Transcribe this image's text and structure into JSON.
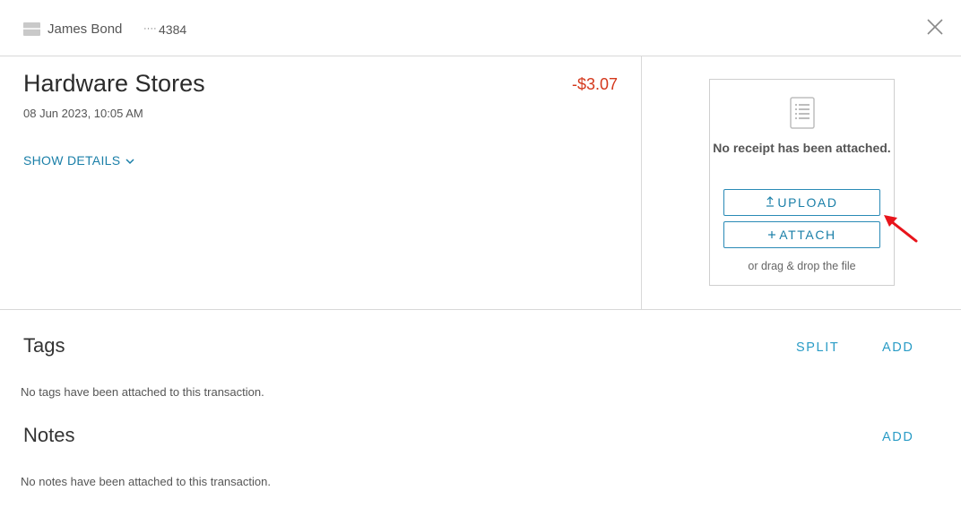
{
  "header": {
    "cardholder": "James Bond",
    "card_mask": "····",
    "card_last4": "4384",
    "icons": {
      "card": "credit-card-icon",
      "close": "close-icon"
    }
  },
  "transaction": {
    "merchant": "Hardware Stores",
    "amount": "-$3.07",
    "datetime": "08 Jun 2023, 10:05 AM",
    "show_details_label": "SHOW DETAILS"
  },
  "receipt": {
    "empty_message": "No receipt has been attached.",
    "upload_label": "UPLOAD",
    "attach_label": "ATTACH",
    "drag_hint": "or drag & drop the file",
    "icons": {
      "document": "receipt-document-icon",
      "upload": "upload-arrow-icon",
      "attach": "plus-icon"
    }
  },
  "tags": {
    "title": "Tags",
    "split_label": "SPLIT",
    "add_label": "ADD",
    "empty_message": "No tags have been attached to this transaction."
  },
  "notes": {
    "title": "Notes",
    "add_label": "ADD",
    "empty_message": "No notes have been attached to this transaction."
  },
  "colors": {
    "accent": "#1a7fa8",
    "link": "#2a9cc6",
    "negative_amount": "#d4381c",
    "annotation_arrow": "#e8141b"
  }
}
